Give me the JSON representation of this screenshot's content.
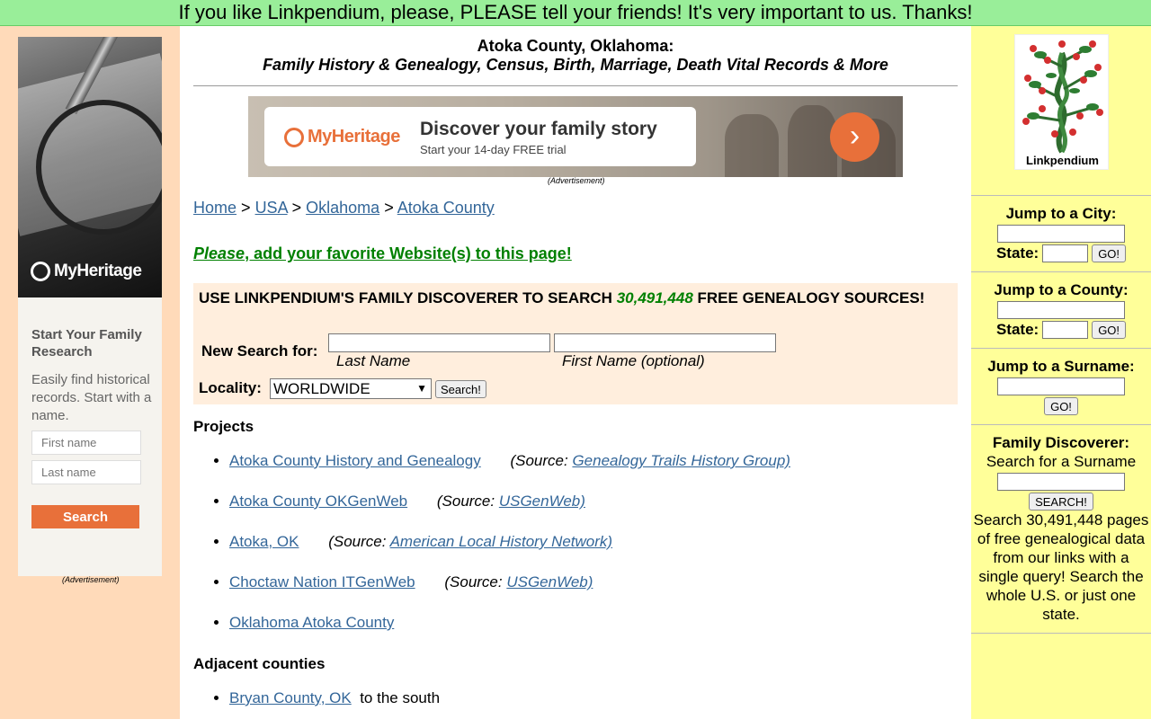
{
  "banner": {
    "text": "If you like Linkpendium, please, PLEASE tell your friends! It's very important to us. Thanks!"
  },
  "left_ad": {
    "brand": "MyHeritage",
    "title": "Start Your Family Research",
    "text": "Easily find historical records. Start with a name.",
    "first_name_placeholder": "First name",
    "last_name_placeholder": "Last name",
    "button": "Search",
    "caption": "(Advertisement)"
  },
  "header": {
    "title": "Atoka County, Oklahoma:",
    "subtitle": "Family History & Genealogy, Census, Birth, Marriage, Death Vital Records & More"
  },
  "main_ad": {
    "brand": "MyHeritage",
    "headline": "Discover your family story",
    "subline": "Start your 14-day FREE trial",
    "arrow": "›",
    "caption": "(Advertisement)"
  },
  "breadcrumb": {
    "home": "Home",
    "sep": ">",
    "usa": "USA",
    "state": "Oklahoma",
    "county": "Atoka County"
  },
  "add_link": {
    "please": "Please",
    "rest": ", add your favorite Website(s) to this page!"
  },
  "search": {
    "heading_pre": "USE LINKPENDIUM'S FAMILY DISCOVERER TO SEARCH ",
    "count": "30,491,448",
    "heading_post": " FREE GENEALOGY SOURCES!",
    "new_search_label": "New Search for:",
    "last_name_caption": "Last Name",
    "first_name_caption": "First Name (optional)",
    "locality_label": "Locality:",
    "locality_value": "WORLDWIDE",
    "button": "Search!"
  },
  "projects": {
    "title": "Projects",
    "items": [
      {
        "link": "Atoka County History and Genealogy",
        "source_pre": "(Source: ",
        "source": "Genealogy Trails History Group)"
      },
      {
        "link": "Atoka County OKGenWeb",
        "source_pre": "(Source: ",
        "source": "USGenWeb)"
      },
      {
        "link": "Atoka, OK",
        "source_pre": "(Source: ",
        "source": "American Local History Network)"
      },
      {
        "link": "Choctaw Nation ITGenWeb",
        "source_pre": "(Source: ",
        "source": "USGenWeb)"
      },
      {
        "link": "Oklahoma Atoka County"
      }
    ]
  },
  "adjacent": {
    "title": "Adjacent counties",
    "items": [
      {
        "link": "Bryan County, OK",
        "suffix": "to the south"
      }
    ]
  },
  "right": {
    "logo_text": "Linkpendium",
    "city": {
      "title": "Jump to a City:",
      "state_label": "State:",
      "go": "GO!"
    },
    "county": {
      "title": "Jump to a County:",
      "state_label": "State:",
      "go": "GO!"
    },
    "surname": {
      "title": "Jump to a Surname:",
      "go": "GO!"
    },
    "discoverer": {
      "title": "Family Discoverer:",
      "subtitle": "Search for a Surname",
      "button": "SEARCH!",
      "text": "Search 30,491,448 pages of free genealogical data from our links with a single query! Search the whole U.S. or just one state."
    }
  },
  "colors": {
    "banner": "#99ee99",
    "left_bg": "#ffdab9",
    "right_bg": "#ffff99",
    "search_bg": "#ffeedd",
    "link": "#336699",
    "accent": "#e8703a",
    "green": "#008000"
  }
}
